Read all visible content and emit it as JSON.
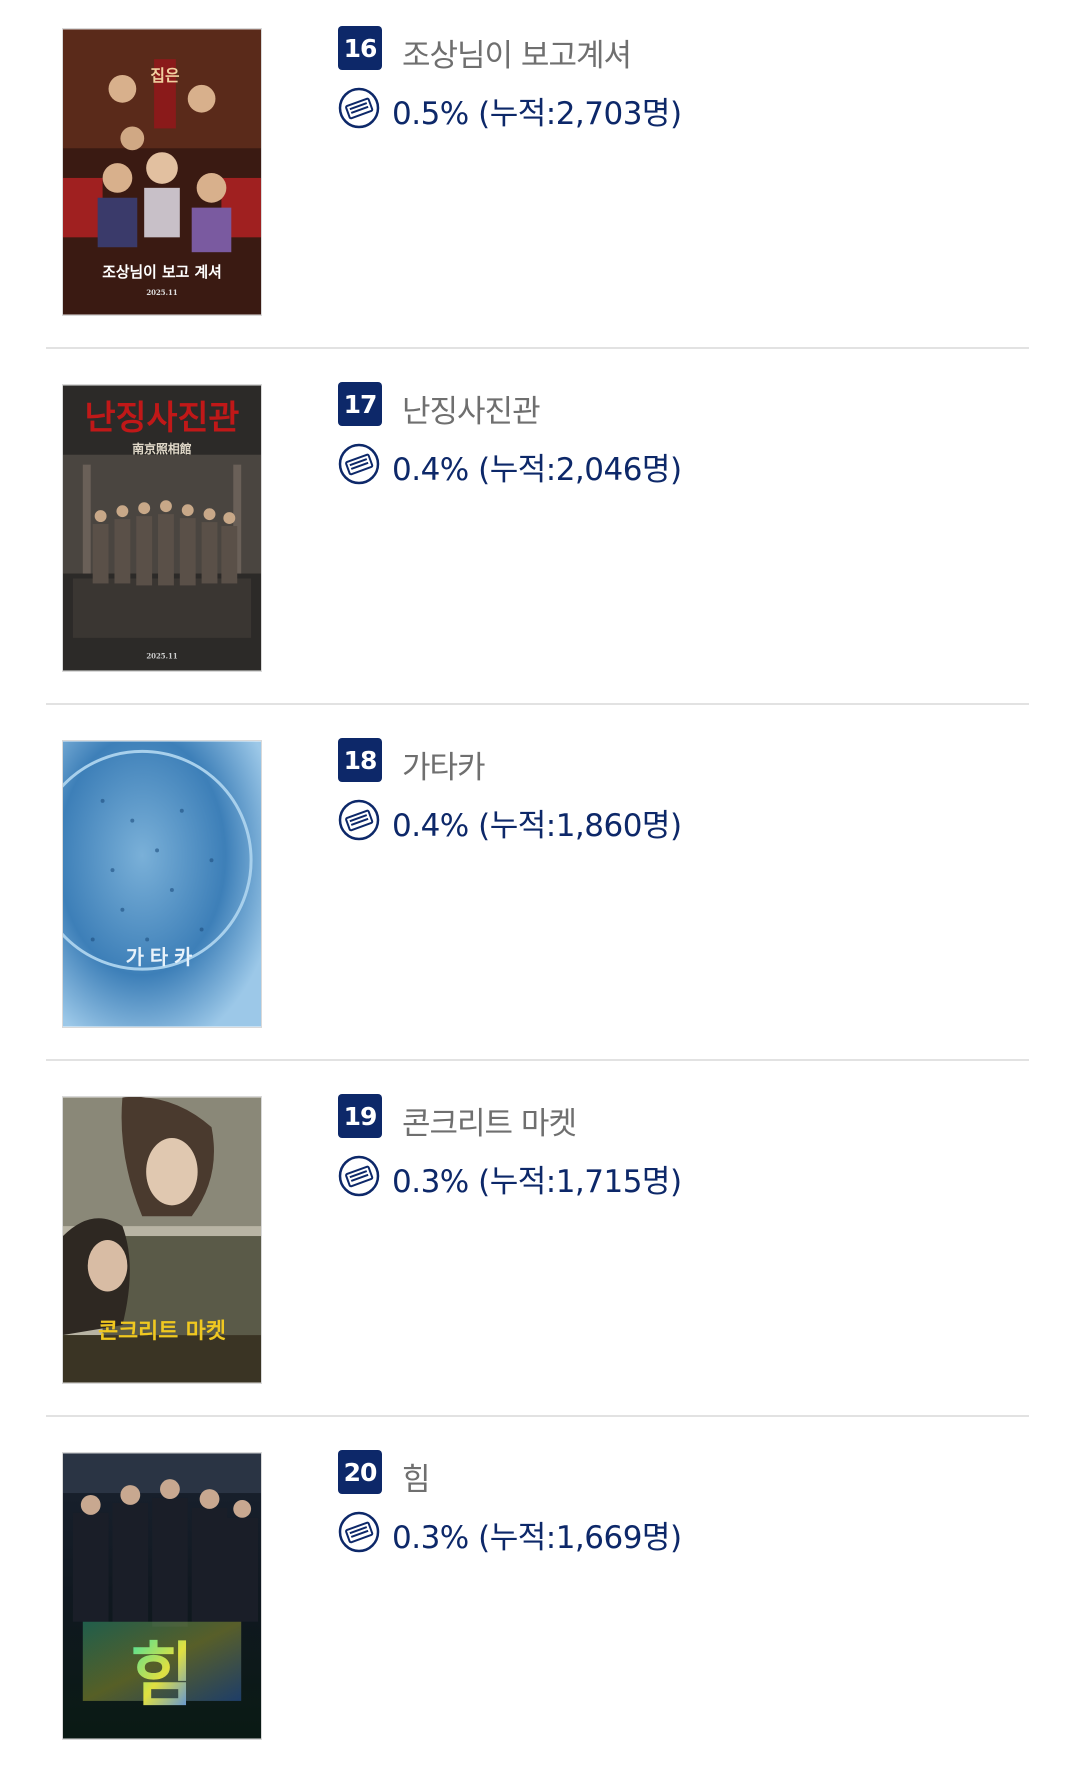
{
  "colors": {
    "rank_badge_bg": "#0d2869",
    "stat_text": "#0d2869",
    "title_text": "#6f6f6f",
    "divider": "#e2e2e2"
  },
  "movies": [
    {
      "rank": "16",
      "title": "조상님이 보고계셔",
      "stat": "0.5% (누적:2,703명)",
      "poster": {
        "icon": "poster-image",
        "lettering": [
          "집은",
          "조상님이 보고 계셔",
          "2025.11"
        ]
      }
    },
    {
      "rank": "17",
      "title": "난징사진관",
      "stat": "0.4% (누적:2,046명)",
      "poster": {
        "icon": "poster-image",
        "lettering": [
          "난징사진관",
          "南京照相館",
          "2025.11"
        ]
      }
    },
    {
      "rank": "18",
      "title": "가타카",
      "stat": "0.4% (누적:1,860명)",
      "poster": {
        "icon": "poster-image",
        "lettering": [
          "가타카"
        ]
      }
    },
    {
      "rank": "19",
      "title": "콘크리트 마켓",
      "stat": "0.3% (누적:1,715명)",
      "poster": {
        "icon": "poster-image",
        "lettering": [
          "콘크리트 마켓"
        ]
      }
    },
    {
      "rank": "20",
      "title": "힘",
      "stat": "0.3% (누적:1,669명)",
      "poster": {
        "icon": "poster-image",
        "lettering": [
          "힘"
        ]
      }
    }
  ],
  "icons": {
    "stat": "ticket-icon"
  }
}
